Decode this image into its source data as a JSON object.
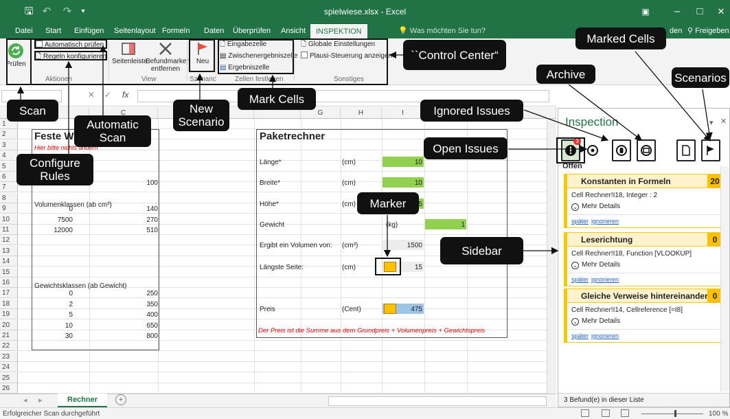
{
  "window": {
    "title": "spielwiese.xlsx - Excel",
    "ribbon_options": "▣",
    "minimize": "–",
    "maximize": "□",
    "close": "✕",
    "save_icon": "🖫",
    "undo": "↶",
    "redo": "↷",
    "customize": "▾"
  },
  "menu": {
    "tabs": [
      "Datei",
      "Start",
      "Einfügen",
      "Seitenlayout",
      "Formeln",
      "Daten",
      "Überprüfen",
      "Ansicht",
      "INSPEKTION"
    ],
    "tell_me": "Was möchten Sie tun?",
    "user_partial": "den",
    "share": "Freigeben"
  },
  "ribbon": {
    "pruefen": "Prüfen",
    "automatisch": "Automatisch prüfen",
    "regeln": "Regeln konfigurieren",
    "aktionen": "Aktionen",
    "seitenleiste": "Seitenleiste",
    "befundmarker": "Befundmarker",
    "entfernen": "entfernen",
    "view": "View",
    "neu": "Neu",
    "szenario": "Szenario",
    "eingabezelle": "Eingabezelle",
    "zwischenergebnis": "Zwischenergebniszelle",
    "ergebniszelle": "Ergebniszelle",
    "zellen_festlegen": "Zellen festlegen",
    "globale": "Globale Einstellungen",
    "plausi": "Plausi-Steuerung anzeigen",
    "sonstiges": "Sonstiges"
  },
  "formula_bar": {
    "cancel": "✕",
    "enter": "✓",
    "fx": "fx"
  },
  "grid": {
    "columns": [
      "",
      "C",
      "",
      "",
      "G",
      "H",
      "I",
      "",
      ""
    ],
    "rows": [
      "1",
      "2",
      "3",
      "4",
      "5",
      "6",
      "7",
      "8",
      "9",
      "10",
      "11",
      "12",
      "13",
      "14",
      "15",
      "16",
      "17",
      "18",
      "19",
      "20",
      "21",
      "22",
      "23",
      "24",
      "25",
      "26"
    ]
  },
  "left_table": {
    "title": "Feste W",
    "hint": "Hier bitte nichts ändern",
    "r6_value": "100",
    "vol_header": "Volumenklassen (ab cm³)",
    "vol_rows": [
      [
        "0",
        "140"
      ],
      [
        "7500",
        "270"
      ],
      [
        "12000",
        "510"
      ]
    ],
    "gew_header": "Gewichtsklassen (ab Gewicht)",
    "gew_rows": [
      [
        "0",
        "250"
      ],
      [
        "2",
        "350"
      ],
      [
        "5",
        "400"
      ],
      [
        "10",
        "650"
      ],
      [
        "30",
        "800"
      ]
    ]
  },
  "right_table": {
    "title": "Paketrechner",
    "laenge": "Länge*",
    "laenge_unit": "(cm)",
    "laenge_val": "10",
    "breite": "Breite*",
    "breite_unit": "(cm)",
    "breite_val": "10",
    "hoehe": "Höhe*",
    "hoehe_unit": "(cm)",
    "hoehe_val": "15",
    "gewicht": "Gewicht",
    "gewicht_unit": "(kg)",
    "gewicht_val": "1",
    "volumen": "Ergibt ein Volumen von:",
    "volumen_unit": "(cm³)",
    "volumen_val": "1500",
    "seite": "Längste Seite:",
    "seite_unit": "(cm)",
    "seite_val": "15",
    "preis": "Preis",
    "preis_unit": "(Cent)",
    "preis_val": "475",
    "note": "Der Preis ist die Summe aus dem Grundpreis + Volumenpreis + Gewichtspreis"
  },
  "sheets": {
    "active": "Rechner",
    "add": "+",
    "prev": "◂",
    "next": "▸"
  },
  "status": {
    "message": "Erfolgreicher Scan durchgeführt",
    "zoom": "100 %"
  },
  "sidebar": {
    "title": "Inspection",
    "close": "✕",
    "menu": "▾",
    "badge": "3",
    "offen": "Offen",
    "issues": [
      {
        "title": "Konstanten in Formeln",
        "count": "20",
        "detail": "Cell Rechner!I18, Integer : 2",
        "more": "Mehr Details",
        "later": "später",
        "ignore": "ignorieren"
      },
      {
        "title": "Leserichtung",
        "count": "0",
        "detail": "Cell Rechner!I18, Function [VLOOKUP]",
        "more": "Mehr Details",
        "later": "später",
        "ignore": "ignorieren"
      },
      {
        "title": "Gleiche Verweise hintereinander",
        "count": "0",
        "detail": "Cell Rechner!I14, Cellreference [=I8]",
        "more": "Mehr Details",
        "later": "später",
        "ignore": "ignorieren"
      }
    ],
    "footer": "3 Befund(e) in dieser Liste"
  },
  "callouts": {
    "control_center": "``Control Center“",
    "marked_cells": "Marked Cells",
    "archive": "Archive",
    "scenarios": "Scenarios",
    "scan": "Scan",
    "automatic_scan": "Automatic Scan",
    "new_scenario": "New Scenario",
    "mark_cells": "Mark Cells",
    "ignored_issues": "Ignored Issues",
    "open_issues": "Open Issues",
    "configure_rules": "Configure Rules",
    "marker": "Marker",
    "sidebar": "Sidebar"
  }
}
